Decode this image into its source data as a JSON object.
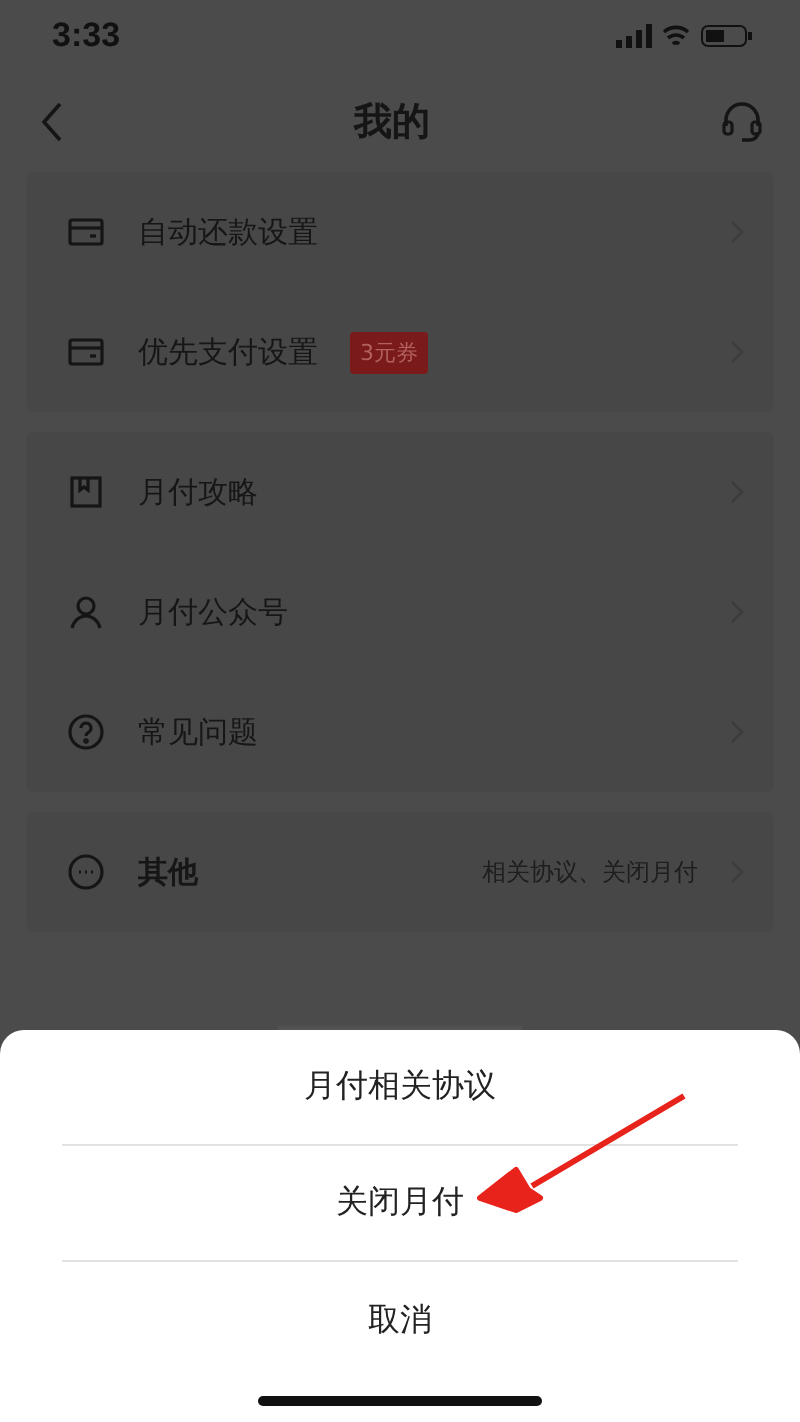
{
  "status_bar": {
    "time": "3:33"
  },
  "nav": {
    "title": "我的"
  },
  "groups": [
    {
      "rows": [
        {
          "kind": "card",
          "label": "自动还款设置"
        },
        {
          "kind": "card",
          "label": "优先支付设置",
          "badge": "3元券"
        }
      ]
    },
    {
      "rows": [
        {
          "kind": "bookmark",
          "label": "月付攻略"
        },
        {
          "kind": "person",
          "label": "月付公众号"
        },
        {
          "kind": "question",
          "label": "常见问题"
        }
      ]
    },
    {
      "rows": [
        {
          "kind": "more",
          "label": "其他",
          "detail": "相关协议、关闭月付"
        }
      ]
    }
  ],
  "action_sheet": {
    "options": [
      "月付相关协议",
      "关闭月付"
    ],
    "cancel": "取消"
  }
}
